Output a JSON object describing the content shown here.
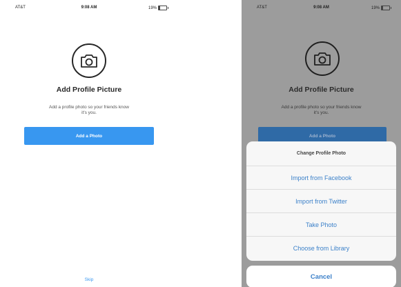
{
  "status_bar": {
    "carrier": "AT&T",
    "time": "9:08 AM",
    "battery": "19%",
    "battery_level": 0.19
  },
  "profile_setup": {
    "icon": "camera-icon",
    "title": "Add Profile Picture",
    "description_line1": "Add a profile photo so your friends know",
    "description_line2": "it's you.",
    "add_button_label": "Add a Photo",
    "skip_label": "Skip"
  },
  "action_sheet": {
    "title": "Change Profile Photo",
    "options": [
      {
        "label": "Import from Facebook"
      },
      {
        "label": "Import from Twitter"
      },
      {
        "label": "Take Photo"
      },
      {
        "label": "Choose from Library"
      }
    ],
    "cancel_label": "Cancel"
  },
  "colors": {
    "accent": "#3897f0",
    "dim_overlay": "#9c9c9c",
    "sheet_text": "#3b80c9"
  }
}
